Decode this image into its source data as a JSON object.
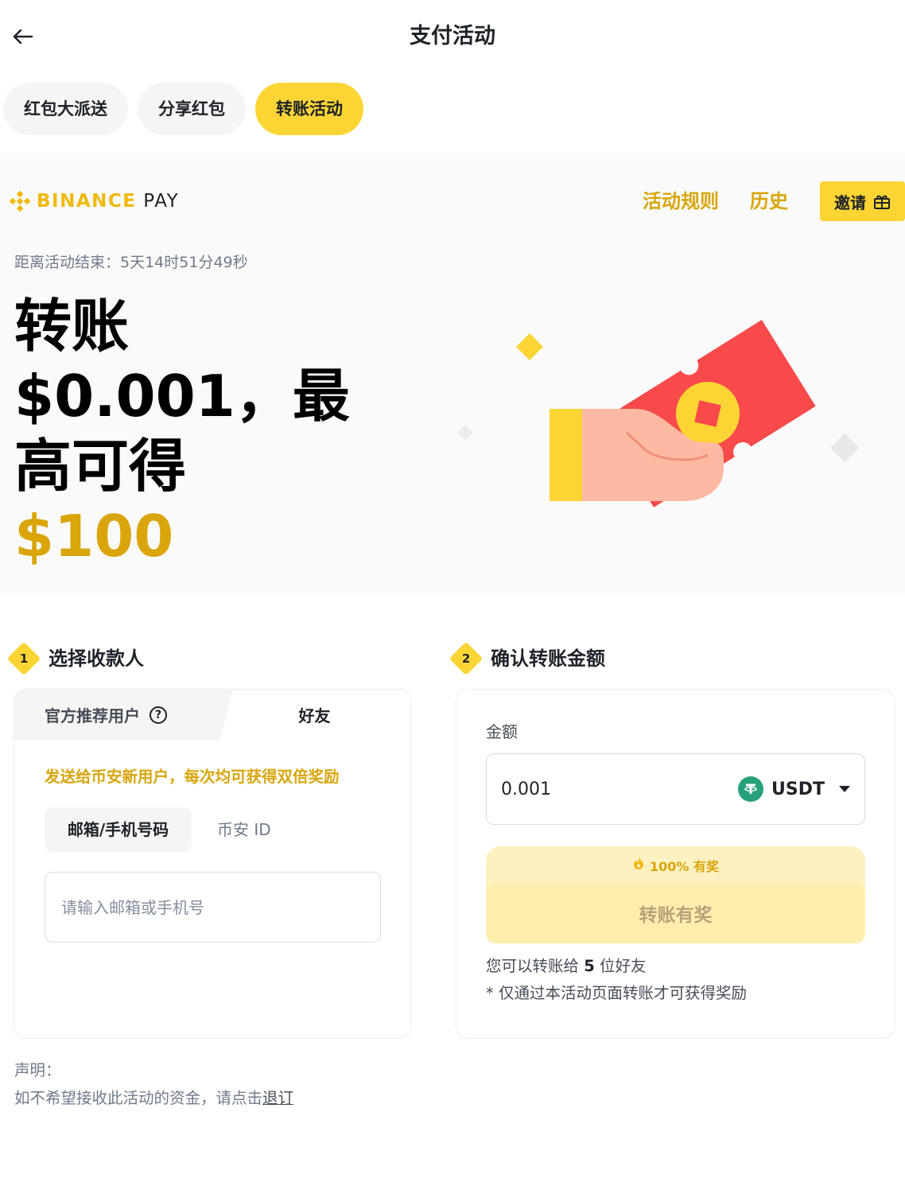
{
  "header": {
    "title": "支付活动",
    "back_icon": "arrow-left-icon"
  },
  "tabs": [
    {
      "label": "红包大派送",
      "active": false
    },
    {
      "label": "分享红包",
      "active": false
    },
    {
      "label": "转账活动",
      "active": true
    }
  ],
  "hero": {
    "brand_part1": "BINANCE",
    "brand_part2": "PAY",
    "rules_link": "活动规则",
    "history_link": "历史",
    "invite_label": "邀请",
    "countdown": "距离活动结束：5天14时51分49秒",
    "headline_line1": "转账",
    "headline_line2": "$0.001，最",
    "headline_line3": "高可得",
    "headline_amount": "$100"
  },
  "step1": {
    "number": "1",
    "title": "选择收款人",
    "segment_recommended": "官方推荐用户",
    "segment_friends": "好友",
    "promo_text": "发送给币安新用户，每次均可获得双倍奖励",
    "subtab_email_phone": "邮箱/手机号码",
    "subtab_binance_id": "币安 ID",
    "input_placeholder": "请输入邮箱或手机号"
  },
  "step2": {
    "number": "2",
    "title": "确认转账金额",
    "amount_label": "金额",
    "amount_value": "0.001",
    "coin": "USDT",
    "reward_badge": "100% 有奖",
    "transfer_button": "转账有奖",
    "friends_prefix": "您可以转账给 ",
    "friends_count": "5",
    "friends_suffix": " 位好友",
    "activity_note": "* 仅通过本活动页面转账才可获得奖励"
  },
  "disclaimer": {
    "title": "声明：",
    "body": "如不希望接收此活动的资金，请点击",
    "link": "退订"
  },
  "colors": {
    "brand_yellow": "#fcd535",
    "accent_gold": "#d9a50b",
    "red_packet": "#f84a4a",
    "tether_green": "#26a17b"
  }
}
